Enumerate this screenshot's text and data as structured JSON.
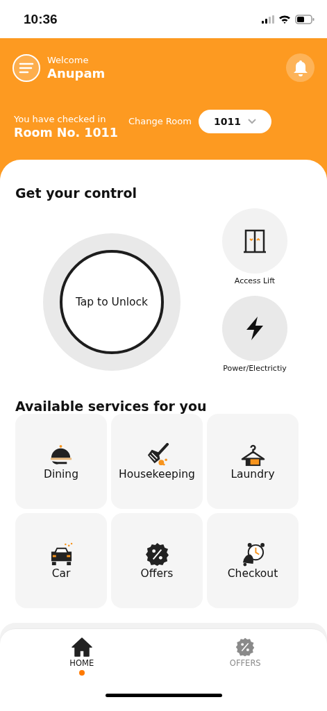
{
  "status_bar": {
    "time": "10:36"
  },
  "header": {
    "greeting": "Welcome",
    "user_name": "Anupam",
    "checkin_label": "You have checked in",
    "room": "Room No. 1011",
    "change_room_label": "Change Room",
    "room_select": {
      "value": "1011"
    }
  },
  "control": {
    "title": "Get your control",
    "unlock": {
      "label": "Tap to Unlock"
    },
    "actions": [
      {
        "kind": "lift",
        "label": "Access Lift"
      },
      {
        "kind": "power",
        "label": "Power/Electrictiy"
      }
    ]
  },
  "services": {
    "title": "Available services for you",
    "items": [
      {
        "kind": "dining",
        "label": "Dining"
      },
      {
        "kind": "housekeeping",
        "label": "Housekeeping"
      },
      {
        "kind": "laundry",
        "label": "Laundry"
      },
      {
        "kind": "car",
        "label": "Car"
      },
      {
        "kind": "offers",
        "label": "Offers"
      },
      {
        "kind": "checkout",
        "label": "Checkout"
      }
    ]
  },
  "bottom_nav": [
    {
      "kind": "home",
      "label": "HOME",
      "selected": true
    },
    {
      "kind": "offers",
      "label": "OFFERS",
      "selected": false
    }
  ]
}
